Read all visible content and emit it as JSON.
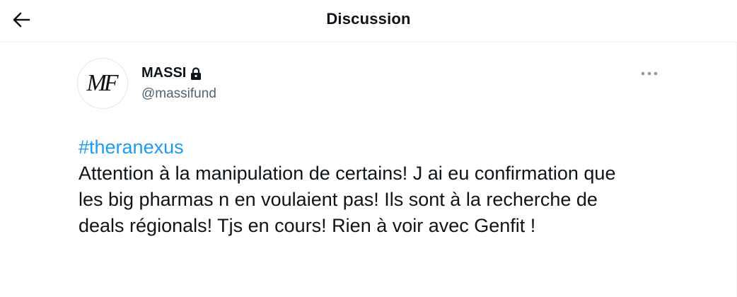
{
  "header": {
    "title": "Discussion",
    "back_icon": "arrow-left-icon"
  },
  "tweet": {
    "author": {
      "display_name": "MASSI",
      "handle": "@massifund",
      "avatar_text": "MF",
      "protected_icon": "lock-icon"
    },
    "more_icon": "more-horizontal-icon",
    "hashtag": "#theranexus",
    "body": "Attention à la manipulation de certains! J ai eu confirmation que les big pharmas n en voulaient pas! Ils sont à la recherche de deals régionals! Tjs en cours! Rien à voir avec Genfit !"
  },
  "colors": {
    "text": "#0f1419",
    "secondary": "#536471",
    "accent": "#1d9bf0",
    "divider": "#eff3f4"
  }
}
